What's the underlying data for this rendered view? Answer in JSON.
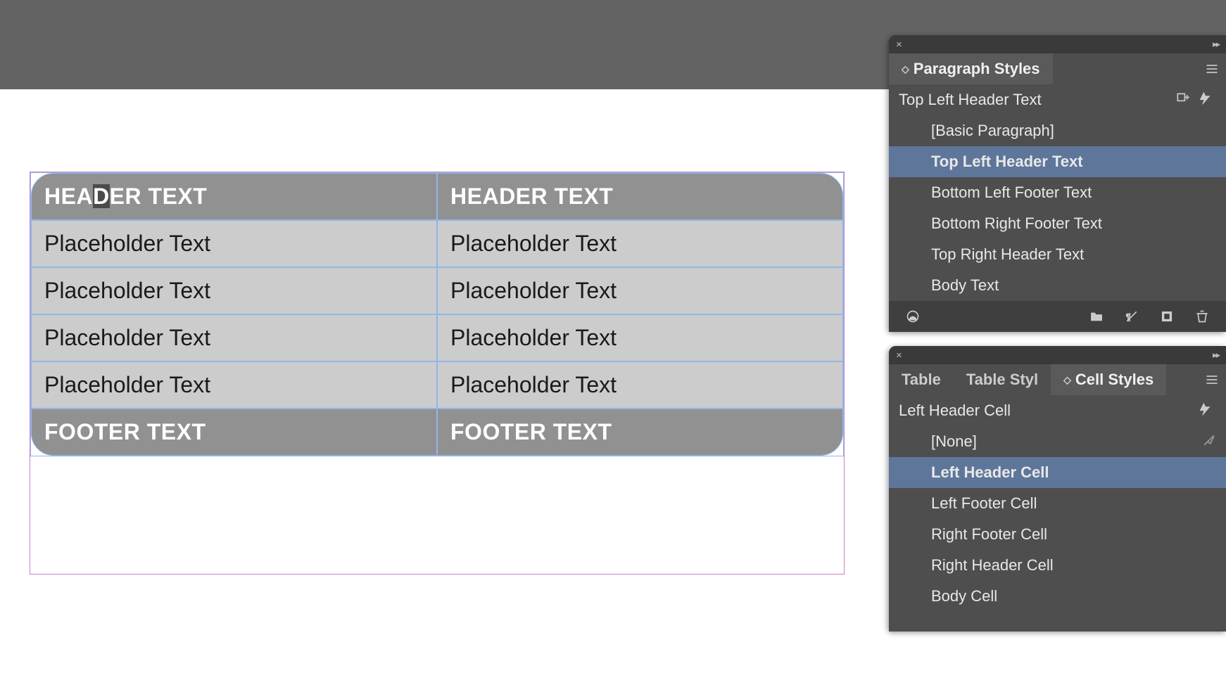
{
  "table": {
    "header": {
      "left": "HEADER TEXT",
      "right": "HEADER TEXT"
    },
    "footer": {
      "left": "FOOTER TEXT",
      "right": "FOOTER TEXT"
    },
    "body": [
      {
        "left": "Placeholder Text",
        "right": "Placeholder Text"
      },
      {
        "left": "Placeholder Text",
        "right": "Placeholder Text"
      },
      {
        "left": "Placeholder Text",
        "right": "Placeholder Text"
      },
      {
        "left": "Placeholder Text",
        "right": "Placeholder Text"
      }
    ],
    "cursor_cell_prefix": "HEA",
    "cursor_cell_char": "D",
    "cursor_cell_suffix": "ER TEXT"
  },
  "paragraph_panel": {
    "title": "Paragraph Styles",
    "current": "Top Left Header Text",
    "items": [
      {
        "label": "[Basic Paragraph]",
        "selected": false
      },
      {
        "label": "Top Left Header Text",
        "selected": true
      },
      {
        "label": "Bottom Left Footer Text",
        "selected": false
      },
      {
        "label": "Bottom Right Footer Text",
        "selected": false
      },
      {
        "label": "Top Right Header Text",
        "selected": false
      },
      {
        "label": "Body Text",
        "selected": false
      }
    ]
  },
  "cell_panel": {
    "tabs": [
      {
        "label": "Table",
        "active": false
      },
      {
        "label": "Table Styl",
        "active": false
      },
      {
        "label": "Cell Styles",
        "active": true
      }
    ],
    "current": "Left Header Cell",
    "items": [
      {
        "label": "[None]",
        "selected": false,
        "badge": true
      },
      {
        "label": "Left Header Cell",
        "selected": true,
        "badge": false
      },
      {
        "label": "Left Footer Cell",
        "selected": false,
        "badge": false
      },
      {
        "label": "Right Footer Cell",
        "selected": false,
        "badge": false
      },
      {
        "label": "Right Header Cell",
        "selected": false,
        "badge": false
      },
      {
        "label": "Body Cell",
        "selected": false,
        "badge": false
      }
    ]
  }
}
